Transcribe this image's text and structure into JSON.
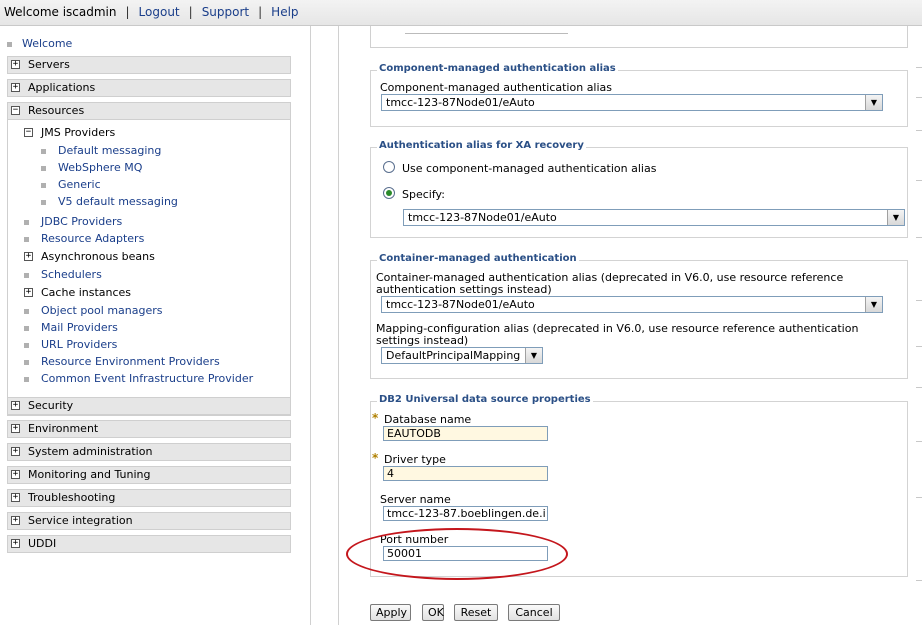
{
  "topbar": {
    "welcome": "Welcome iscadmin",
    "links": [
      "Logout",
      "Support",
      "Help"
    ]
  },
  "nav": {
    "welcome": "Welcome",
    "categories_top": [
      "Servers",
      "Applications",
      "Resources"
    ],
    "resources": {
      "jms_providers": "JMS Providers",
      "jms_children": [
        "Default messaging",
        "WebSphere MQ",
        "Generic",
        "V5 default messaging"
      ],
      "items": [
        {
          "label": "JDBC Providers",
          "kind": "bullet"
        },
        {
          "label": "Resource Adapters",
          "kind": "bullet"
        },
        {
          "label": "Asynchronous beans",
          "kind": "expand"
        },
        {
          "label": "Schedulers",
          "kind": "bullet"
        },
        {
          "label": "Cache instances",
          "kind": "expand"
        },
        {
          "label": "Object pool managers",
          "kind": "bullet"
        },
        {
          "label": "Mail Providers",
          "kind": "bullet"
        },
        {
          "label": "URL Providers",
          "kind": "bullet"
        },
        {
          "label": "Resource Environment Providers",
          "kind": "bullet"
        },
        {
          "label": "Common Event Infrastructure Provider",
          "kind": "bullet"
        }
      ]
    },
    "categories_bottom": [
      "Security",
      "Environment",
      "System administration",
      "Monitoring and Tuning",
      "Troubleshooting",
      "Service integration",
      "UDDI"
    ]
  },
  "cmaa": {
    "legend": "Component-managed authentication alias",
    "label": "Component-managed authentication alias",
    "value": "tmcc-123-87Node01/eAuto"
  },
  "xa": {
    "legend": "Authentication alias for XA recovery",
    "option1": "Use component-managed authentication alias",
    "option2": "Specify:",
    "selected": "specify",
    "value": "tmcc-123-87Node01/eAuto"
  },
  "container": {
    "legend": "Container-managed authentication",
    "alias_label": "Container-managed authentication alias (deprecated in V6.0, use resource reference authentication settings instead)",
    "alias_value": "tmcc-123-87Node01/eAuto",
    "mapping_label": "Mapping-configuration alias (deprecated in V6.0, use resource reference authentication settings instead)",
    "mapping_value": "DefaultPrincipalMapping"
  },
  "db2": {
    "legend": "DB2 Universal data source properties",
    "database_name_label": "Database name",
    "database_name": "EAUTODB",
    "driver_type_label": "Driver type",
    "driver_type": "4",
    "server_name_label": "Server name",
    "server_name": "tmcc-123-87.boeblingen.de.i",
    "port_label": "Port number",
    "port": "50001",
    "required_marker": "*"
  },
  "buttons": {
    "apply": "Apply",
    "ok": "OK",
    "reset": "Reset",
    "cancel": "Cancel"
  },
  "colors": {
    "link": "#1a3e8a",
    "legend": "#2a4f86",
    "annotation": "#c4161c"
  }
}
